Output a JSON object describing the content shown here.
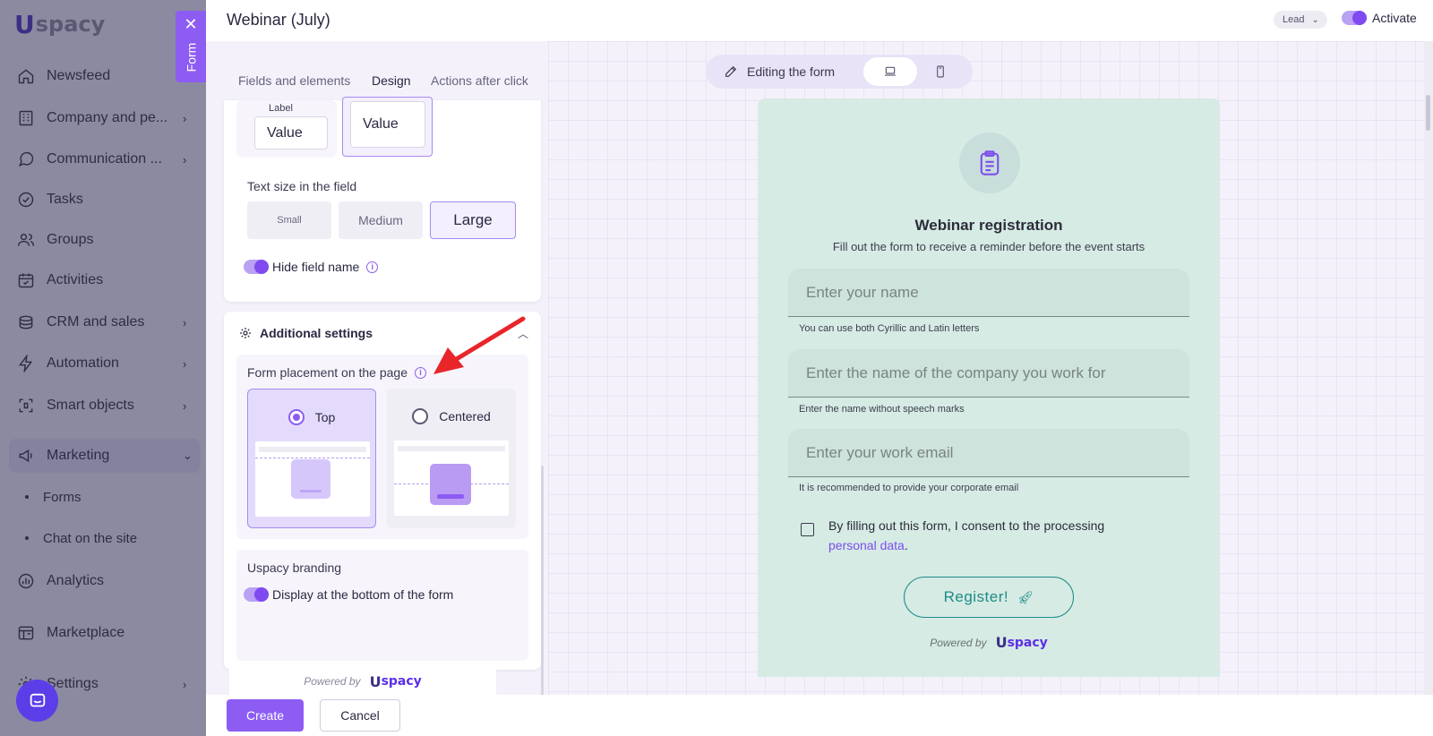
{
  "app": {
    "logo_u": "U",
    "logo_text": "spacy"
  },
  "sidebar": {
    "items": [
      {
        "label": "Newsfeed",
        "icon": "home-icon",
        "chevron": ""
      },
      {
        "label": "Company and pe...",
        "icon": "building-icon",
        "chevron": "›"
      },
      {
        "label": "Communication ...",
        "icon": "chat-icon",
        "chevron": "›"
      },
      {
        "label": "Tasks",
        "icon": "check-circle-icon",
        "chevron": ""
      },
      {
        "label": "Groups",
        "icon": "users-icon",
        "chevron": ""
      },
      {
        "label": "Activities",
        "icon": "calendar-icon",
        "chevron": ""
      },
      {
        "label": "CRM and sales",
        "icon": "coins-icon",
        "chevron": "›"
      },
      {
        "label": "Automation",
        "icon": "bolt-icon",
        "chevron": "›"
      },
      {
        "label": "Smart objects",
        "icon": "smart-object-icon",
        "chevron": "›"
      },
      {
        "label": "Marketing",
        "icon": "megaphone-icon",
        "chevron": "⌄"
      },
      {
        "label": "Analytics",
        "icon": "chart-icon",
        "chevron": ""
      },
      {
        "label": "Marketplace",
        "icon": "store-icon",
        "chevron": ""
      },
      {
        "label": "Settings",
        "icon": "gear-icon",
        "chevron": "›"
      }
    ],
    "subitems": [
      "Forms",
      "Chat on the site"
    ]
  },
  "form_tab": {
    "close": "✕",
    "label": "Form"
  },
  "header": {
    "title": "Webinar (July)",
    "lead_select": "Lead",
    "activate_label": "Activate",
    "activate_on": true
  },
  "tabs": [
    {
      "label": "Fields and elements",
      "active": false
    },
    {
      "label": "Design",
      "active": true
    },
    {
      "label": "Actions after click",
      "active": false
    }
  ],
  "field_style": {
    "label_caption": "Label",
    "option_a_value": "Value",
    "option_b_value": "Value"
  },
  "text_size": {
    "title": "Text size in the field",
    "options": [
      "Small",
      "Medium",
      "Large"
    ],
    "selected": "Large"
  },
  "hide_field_name": {
    "label": "Hide field name",
    "on": true
  },
  "additional_settings": {
    "title": "Additional settings",
    "placement_title": "Form placement on the page",
    "placement_options": [
      "Top",
      "Centered"
    ],
    "placement_selected": "Top",
    "branding_title": "Uspacy branding",
    "branding_toggle_label": "Display at the bottom of the form",
    "branding_on": true,
    "powered_by": "Powered by",
    "brand_u": "U",
    "brand_text": "spacy"
  },
  "footer": {
    "create": "Create",
    "cancel": "Cancel"
  },
  "preview_modes": {
    "edit_label": "Editing the form",
    "selected": "desktop"
  },
  "form_preview": {
    "title": "Webinar registration",
    "subtitle": "Fill out the form to receive a reminder before the event starts",
    "fields": [
      {
        "placeholder": "Enter your name",
        "hint": "You can use both Cyrillic and Latin letters"
      },
      {
        "placeholder": "Enter the name of the company you work for",
        "hint": "Enter the name without speech marks"
      },
      {
        "placeholder": "Enter your work email",
        "hint": "It is recommended to provide your corporate email"
      }
    ],
    "consent_text": "By filling out this form, I consent to the processing",
    "consent_link": "personal data",
    "consent_end": ".",
    "button": "Register!",
    "powered_by": "Powered by",
    "brand_u": "U",
    "brand_text": "spacy"
  },
  "colors": {
    "accent": "#8d5cf3",
    "preview_bg": "#d5ebe4",
    "register_border": "#1f8b86"
  }
}
